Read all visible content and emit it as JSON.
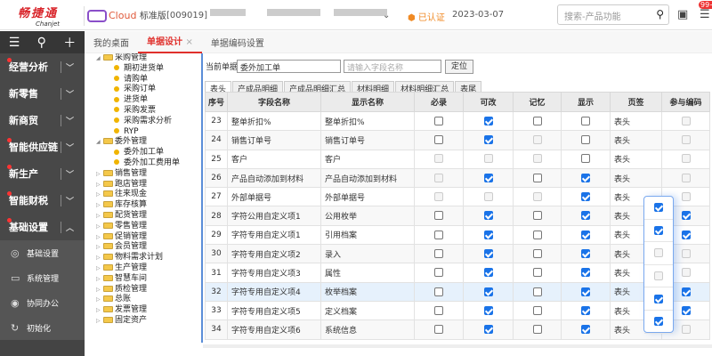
{
  "header": {
    "brand": "畅捷通",
    "brand_en": "Chanjet",
    "product": "Cloud",
    "edition": "标准版",
    "account": "[009019]",
    "verified": "已认证",
    "date": "2023-03-07",
    "search_placeholder": "搜索-产品功能",
    "badge": "99+"
  },
  "sidebar": {
    "items": [
      {
        "label": "经营分析",
        "dot": true
      },
      {
        "label": "新零售",
        "dot": false
      },
      {
        "label": "新商贸",
        "dot": false
      },
      {
        "label": "智能供应链",
        "dot": true
      },
      {
        "label": "新生产",
        "dot": true
      },
      {
        "label": "智能财税",
        "dot": true
      },
      {
        "label": "基础设置",
        "dot": true,
        "expanded": true
      }
    ],
    "subitems": [
      {
        "label": "基础设置",
        "icon": "camera-icon"
      },
      {
        "label": "系统管理",
        "icon": "monitor-icon"
      },
      {
        "label": "协同办公",
        "icon": "collab-icon"
      },
      {
        "label": "初始化",
        "icon": "refresh-icon"
      }
    ]
  },
  "tabs": [
    {
      "label": "我的桌面"
    },
    {
      "label": "单据设计",
      "active": true
    },
    {
      "label": "单据编码设置"
    }
  ],
  "tree": [
    {
      "label": "采购管理",
      "type": "folder",
      "open": true,
      "level": 0
    },
    {
      "label": "期初进货单",
      "type": "leaf",
      "level": 1
    },
    {
      "label": "请购单",
      "type": "leaf",
      "level": 1
    },
    {
      "label": "采购订单",
      "type": "leaf",
      "level": 1
    },
    {
      "label": "进货单",
      "type": "leaf",
      "level": 1
    },
    {
      "label": "采购发票",
      "type": "leaf",
      "level": 1
    },
    {
      "label": "采购需求分析",
      "type": "leaf",
      "level": 1
    },
    {
      "label": "RYP",
      "type": "leaf",
      "level": 1
    },
    {
      "label": "委外管理",
      "type": "folder",
      "open": true,
      "level": 0
    },
    {
      "label": "委外加工单",
      "type": "leaf",
      "level": 1
    },
    {
      "label": "委外加工费用单",
      "type": "leaf",
      "level": 1
    },
    {
      "label": "销售管理",
      "type": "folder",
      "level": 0
    },
    {
      "label": "跑店管理",
      "type": "folder",
      "level": 0
    },
    {
      "label": "往来现金",
      "type": "folder",
      "level": 0
    },
    {
      "label": "库存核算",
      "type": "folder",
      "level": 0
    },
    {
      "label": "配货管理",
      "type": "folder",
      "level": 0
    },
    {
      "label": "零售管理",
      "type": "folder",
      "level": 0
    },
    {
      "label": "促销管理",
      "type": "folder",
      "level": 0
    },
    {
      "label": "会员管理",
      "type": "folder",
      "level": 0
    },
    {
      "label": "物料需求计划",
      "type": "folder",
      "level": 0
    },
    {
      "label": "生产管理",
      "type": "folder",
      "level": 0
    },
    {
      "label": "智慧车间",
      "type": "folder",
      "level": 0
    },
    {
      "label": "质检管理",
      "type": "folder",
      "level": 0
    },
    {
      "label": "总账",
      "type": "folder",
      "level": 0
    },
    {
      "label": "发票管理",
      "type": "folder",
      "level": 0
    },
    {
      "label": "固定资产",
      "type": "folder",
      "level": 0
    }
  ],
  "form": {
    "current_label": "当前单据",
    "current_value": "委外加工单",
    "field_placeholder": "请输入字段名称",
    "locate": "定位"
  },
  "subtabs": [
    "表头",
    "产成品明细",
    "产成品明细汇总",
    "材料明细",
    "材料明细汇总",
    "表尾"
  ],
  "table": {
    "columns": [
      "序号",
      "字段名称",
      "显示名称",
      "必录",
      "可改",
      "记忆",
      "显示",
      "页签",
      "参与编码"
    ],
    "rows": [
      {
        "no": "23",
        "field": "整单折扣%",
        "display": "整单折扣%",
        "flags": [
          "u",
          "c",
          "u",
          "u",
          "d"
        ],
        "tab": "表头"
      },
      {
        "no": "24",
        "field": "销售订单号",
        "display": "销售订单号",
        "flags": [
          "u",
          "c",
          "d",
          "u",
          "d"
        ],
        "tab": "表头"
      },
      {
        "no": "25",
        "field": "客户",
        "display": "客户",
        "flags": [
          "d",
          "d",
          "d",
          "u",
          "d"
        ],
        "tab": "表头"
      },
      {
        "no": "26",
        "field": "产品自动添加到材料",
        "display": "产品自动添加到材料",
        "flags": [
          "d",
          "c",
          "u",
          "c",
          "d"
        ],
        "tab": "表头"
      },
      {
        "no": "27",
        "field": "外部单据号",
        "display": "外部单据号",
        "flags": [
          "d",
          "d",
          "d",
          "c",
          "d"
        ],
        "tab": "表头"
      },
      {
        "no": "28",
        "field": "字符公用自定义项1",
        "display": "公用枚举",
        "flags": [
          "u",
          "c",
          "u",
          "c",
          "c"
        ],
        "tab": "表头"
      },
      {
        "no": "29",
        "field": "字符专用自定义项1",
        "display": "引用档案",
        "flags": [
          "u",
          "c",
          "u",
          "c",
          "c"
        ],
        "tab": "表头"
      },
      {
        "no": "30",
        "field": "字符专用自定义项2",
        "display": "录入",
        "flags": [
          "u",
          "c",
          "u",
          "c",
          "d"
        ],
        "tab": "表头"
      },
      {
        "no": "31",
        "field": "字符专用自定义项3",
        "display": "属性",
        "flags": [
          "u",
          "c",
          "u",
          "c",
          "d"
        ],
        "tab": "表头"
      },
      {
        "no": "32",
        "field": "字符专用自定义项4",
        "display": "枚举档案",
        "flags": [
          "u",
          "c",
          "u",
          "c",
          "c"
        ],
        "tab": "表头",
        "selected": true
      },
      {
        "no": "33",
        "field": "字符专用自定义项5",
        "display": "定义档案",
        "flags": [
          "u",
          "c",
          "u",
          "c",
          "c"
        ],
        "tab": "表头"
      },
      {
        "no": "34",
        "field": "字符专用自定义项6",
        "display": "系统信息",
        "flags": [
          "u",
          "c",
          "u",
          "c",
          "d"
        ],
        "tab": "表头"
      }
    ]
  },
  "popup": [
    "c",
    "c",
    "d",
    "d",
    "c",
    "c"
  ]
}
